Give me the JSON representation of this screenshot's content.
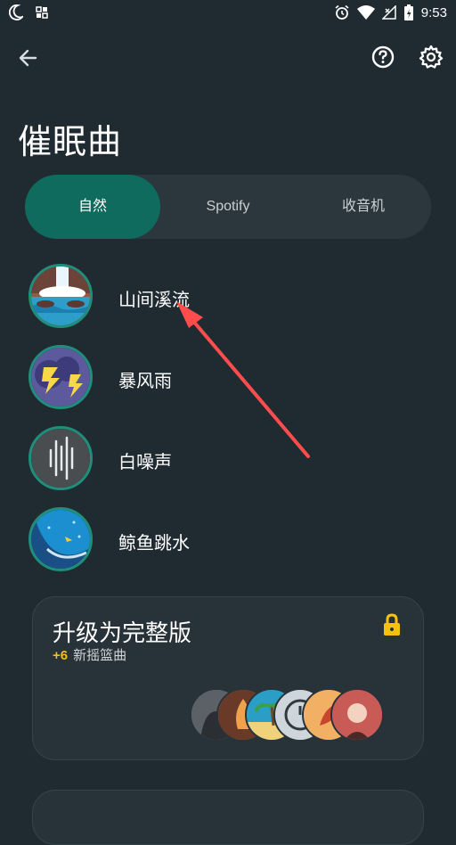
{
  "status_bar": {
    "time": "9:53"
  },
  "header": {
    "title": "催眠曲"
  },
  "tabs": [
    {
      "label": "自然",
      "active": true
    },
    {
      "label": "Spotify",
      "active": false
    },
    {
      "label": "收音机",
      "active": false
    }
  ],
  "sounds": [
    {
      "label": "山间溪流",
      "icon": "waterfall-thumbnail"
    },
    {
      "label": "暴风雨",
      "icon": "storm-thumbnail"
    },
    {
      "label": "白噪声",
      "icon": "white-noise-thumbnail"
    },
    {
      "label": "鲸鱼跳水",
      "icon": "whale-thumbnail"
    }
  ],
  "upgrade": {
    "title": "升级为完整版",
    "plus": "+6",
    "subtitle": "新摇篮曲"
  },
  "colors": {
    "background": "#1f2a31",
    "accent": "#0f6b5e",
    "ring": "#1f8f7c",
    "lock": "#f4c20d",
    "arrow": "#ff4d4d"
  }
}
